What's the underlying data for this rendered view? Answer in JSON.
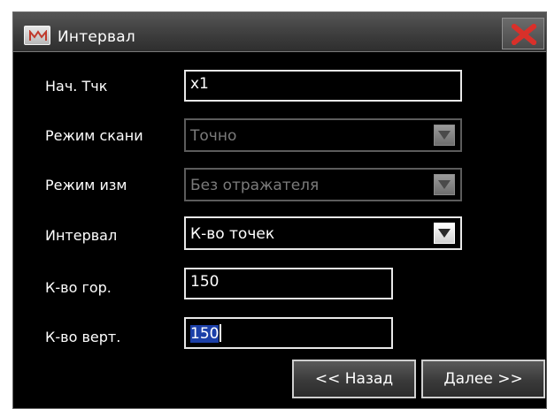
{
  "window": {
    "title": "Интервал",
    "app_icon": "m-app-icon",
    "close_icon": "close-x-icon",
    "accent_close": "#d9302a"
  },
  "form": {
    "start_point": {
      "label": "Нач. Тчк",
      "value": "x1"
    },
    "scan_mode": {
      "label": "Режим скани",
      "value": "Точно",
      "enabled": false
    },
    "measure_mode": {
      "label": "Режим изм",
      "value": "Без отражателя",
      "enabled": false
    },
    "interval": {
      "label": "Интервал",
      "value": "К-во точек",
      "enabled": true
    },
    "count_horizontal": {
      "label": "К-во гор.",
      "value": "150"
    },
    "count_vertical": {
      "label": "К-во верт.",
      "value": "150"
    }
  },
  "buttons": {
    "back": "<< Назад",
    "next": "Далее >>"
  }
}
